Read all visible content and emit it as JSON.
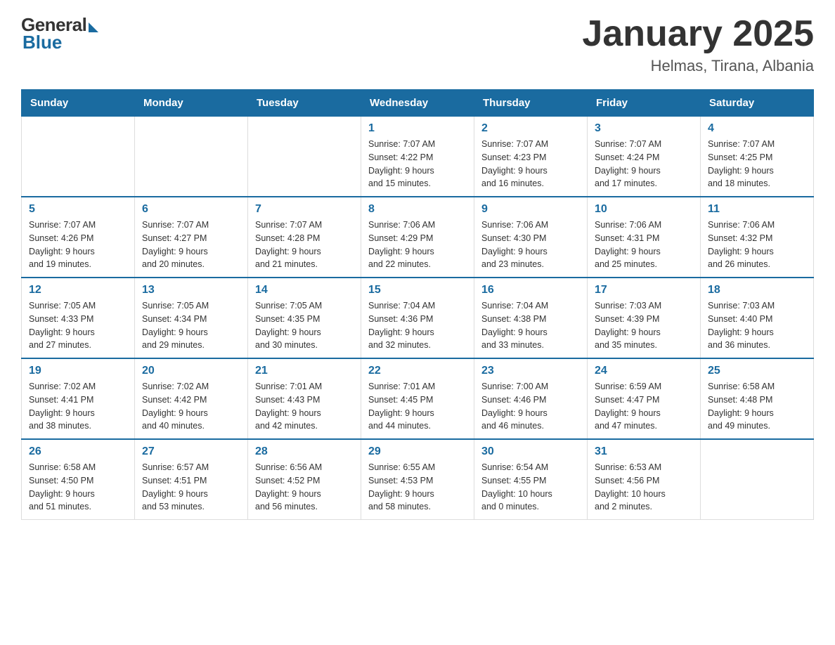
{
  "logo": {
    "general": "General",
    "blue": "Blue"
  },
  "title": "January 2025",
  "location": "Helmas, Tirana, Albania",
  "days_of_week": [
    "Sunday",
    "Monday",
    "Tuesday",
    "Wednesday",
    "Thursday",
    "Friday",
    "Saturday"
  ],
  "weeks": [
    [
      {
        "day": "",
        "info": ""
      },
      {
        "day": "",
        "info": ""
      },
      {
        "day": "",
        "info": ""
      },
      {
        "day": "1",
        "info": "Sunrise: 7:07 AM\nSunset: 4:22 PM\nDaylight: 9 hours\nand 15 minutes."
      },
      {
        "day": "2",
        "info": "Sunrise: 7:07 AM\nSunset: 4:23 PM\nDaylight: 9 hours\nand 16 minutes."
      },
      {
        "day": "3",
        "info": "Sunrise: 7:07 AM\nSunset: 4:24 PM\nDaylight: 9 hours\nand 17 minutes."
      },
      {
        "day": "4",
        "info": "Sunrise: 7:07 AM\nSunset: 4:25 PM\nDaylight: 9 hours\nand 18 minutes."
      }
    ],
    [
      {
        "day": "5",
        "info": "Sunrise: 7:07 AM\nSunset: 4:26 PM\nDaylight: 9 hours\nand 19 minutes."
      },
      {
        "day": "6",
        "info": "Sunrise: 7:07 AM\nSunset: 4:27 PM\nDaylight: 9 hours\nand 20 minutes."
      },
      {
        "day": "7",
        "info": "Sunrise: 7:07 AM\nSunset: 4:28 PM\nDaylight: 9 hours\nand 21 minutes."
      },
      {
        "day": "8",
        "info": "Sunrise: 7:06 AM\nSunset: 4:29 PM\nDaylight: 9 hours\nand 22 minutes."
      },
      {
        "day": "9",
        "info": "Sunrise: 7:06 AM\nSunset: 4:30 PM\nDaylight: 9 hours\nand 23 minutes."
      },
      {
        "day": "10",
        "info": "Sunrise: 7:06 AM\nSunset: 4:31 PM\nDaylight: 9 hours\nand 25 minutes."
      },
      {
        "day": "11",
        "info": "Sunrise: 7:06 AM\nSunset: 4:32 PM\nDaylight: 9 hours\nand 26 minutes."
      }
    ],
    [
      {
        "day": "12",
        "info": "Sunrise: 7:05 AM\nSunset: 4:33 PM\nDaylight: 9 hours\nand 27 minutes."
      },
      {
        "day": "13",
        "info": "Sunrise: 7:05 AM\nSunset: 4:34 PM\nDaylight: 9 hours\nand 29 minutes."
      },
      {
        "day": "14",
        "info": "Sunrise: 7:05 AM\nSunset: 4:35 PM\nDaylight: 9 hours\nand 30 minutes."
      },
      {
        "day": "15",
        "info": "Sunrise: 7:04 AM\nSunset: 4:36 PM\nDaylight: 9 hours\nand 32 minutes."
      },
      {
        "day": "16",
        "info": "Sunrise: 7:04 AM\nSunset: 4:38 PM\nDaylight: 9 hours\nand 33 minutes."
      },
      {
        "day": "17",
        "info": "Sunrise: 7:03 AM\nSunset: 4:39 PM\nDaylight: 9 hours\nand 35 minutes."
      },
      {
        "day": "18",
        "info": "Sunrise: 7:03 AM\nSunset: 4:40 PM\nDaylight: 9 hours\nand 36 minutes."
      }
    ],
    [
      {
        "day": "19",
        "info": "Sunrise: 7:02 AM\nSunset: 4:41 PM\nDaylight: 9 hours\nand 38 minutes."
      },
      {
        "day": "20",
        "info": "Sunrise: 7:02 AM\nSunset: 4:42 PM\nDaylight: 9 hours\nand 40 minutes."
      },
      {
        "day": "21",
        "info": "Sunrise: 7:01 AM\nSunset: 4:43 PM\nDaylight: 9 hours\nand 42 minutes."
      },
      {
        "day": "22",
        "info": "Sunrise: 7:01 AM\nSunset: 4:45 PM\nDaylight: 9 hours\nand 44 minutes."
      },
      {
        "day": "23",
        "info": "Sunrise: 7:00 AM\nSunset: 4:46 PM\nDaylight: 9 hours\nand 46 minutes."
      },
      {
        "day": "24",
        "info": "Sunrise: 6:59 AM\nSunset: 4:47 PM\nDaylight: 9 hours\nand 47 minutes."
      },
      {
        "day": "25",
        "info": "Sunrise: 6:58 AM\nSunset: 4:48 PM\nDaylight: 9 hours\nand 49 minutes."
      }
    ],
    [
      {
        "day": "26",
        "info": "Sunrise: 6:58 AM\nSunset: 4:50 PM\nDaylight: 9 hours\nand 51 minutes."
      },
      {
        "day": "27",
        "info": "Sunrise: 6:57 AM\nSunset: 4:51 PM\nDaylight: 9 hours\nand 53 minutes."
      },
      {
        "day": "28",
        "info": "Sunrise: 6:56 AM\nSunset: 4:52 PM\nDaylight: 9 hours\nand 56 minutes."
      },
      {
        "day": "29",
        "info": "Sunrise: 6:55 AM\nSunset: 4:53 PM\nDaylight: 9 hours\nand 58 minutes."
      },
      {
        "day": "30",
        "info": "Sunrise: 6:54 AM\nSunset: 4:55 PM\nDaylight: 10 hours\nand 0 minutes."
      },
      {
        "day": "31",
        "info": "Sunrise: 6:53 AM\nSunset: 4:56 PM\nDaylight: 10 hours\nand 2 minutes."
      },
      {
        "day": "",
        "info": ""
      }
    ]
  ]
}
